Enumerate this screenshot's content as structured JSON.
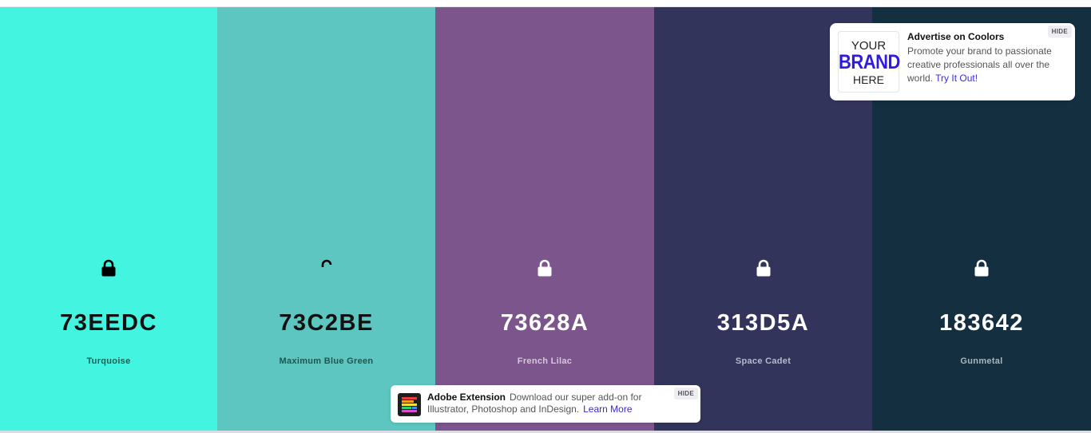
{
  "palette": {
    "colors": [
      {
        "hex": "73EEDC",
        "name": "Turquoise",
        "bg": "#43F5E0",
        "text_color": "#111111",
        "name_color": "#1f5d55",
        "lock_color": "#000000"
      },
      {
        "hex": "73C2BE",
        "name": "Maximum Blue Green",
        "bg": "#5EC6C1",
        "text_color": "#111111",
        "name_color": "#235450",
        "lock_color": "#000000"
      },
      {
        "hex": "73628A",
        "name": "French Lilac",
        "bg": "#7B558C",
        "text_color": "#ffffff",
        "name_color": "#d6c8dc",
        "lock_color": "#ffffff"
      },
      {
        "hex": "313D5A",
        "name": "Space Cadet",
        "bg": "#33345B",
        "text_color": "#ffffff",
        "name_color": "#b8b9cc",
        "lock_color": "#ffffff"
      },
      {
        "hex": "183642",
        "name": "Gunmetal",
        "bg": "#132F40",
        "text_color": "#ffffff",
        "name_color": "#aab7be",
        "lock_color": "#ffffff"
      }
    ]
  },
  "ad": {
    "brand_line1": "YOUR",
    "brand_line2": "BRAND",
    "brand_line3": "HERE",
    "title": "Advertise on Coolors",
    "text": "Promote your brand to passionate creative professionals all over the world.",
    "link": "Try It Out!",
    "hide_label": "HIDE"
  },
  "extension": {
    "title": "Adobe Extension",
    "text": "Download our super add-on for Illustrator, Photoshop and InDesign.",
    "link": "Learn More",
    "hide_label": "HIDE"
  }
}
